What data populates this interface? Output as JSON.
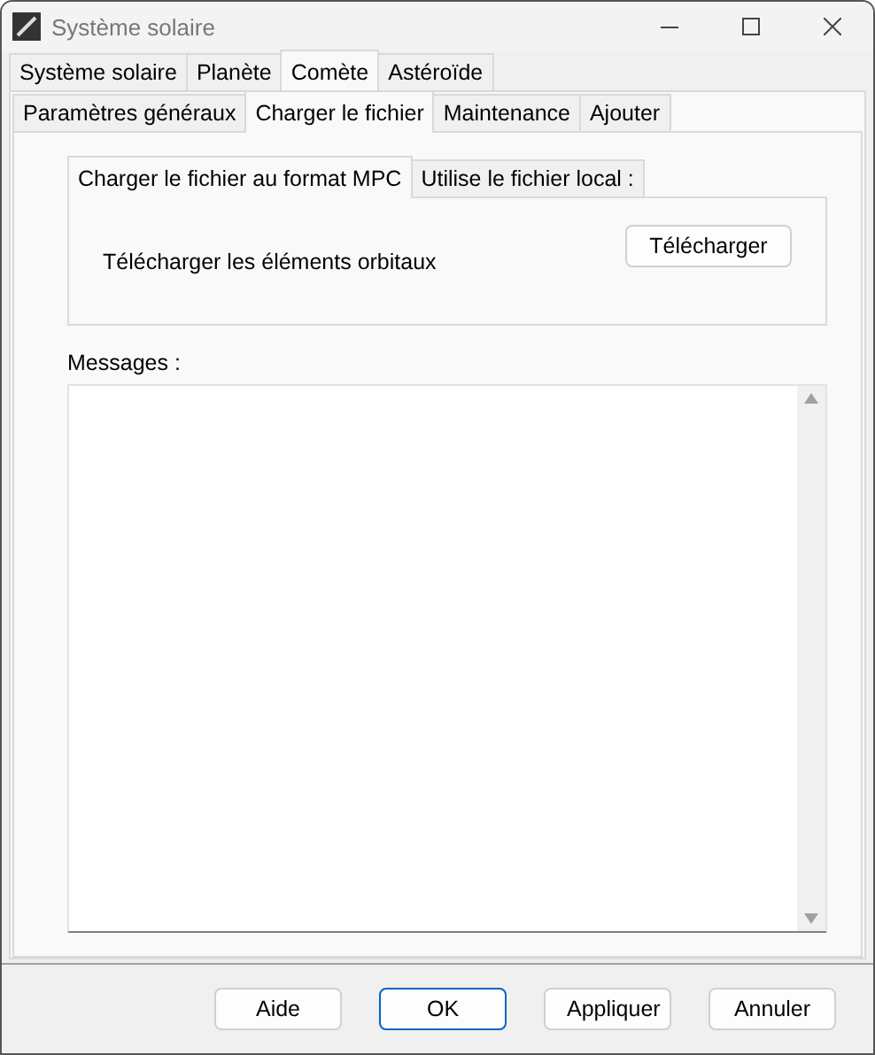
{
  "window": {
    "title": "Système solaire"
  },
  "tabs": [
    {
      "label": "Système solaire",
      "selected": false
    },
    {
      "label": "Planète",
      "selected": false
    },
    {
      "label": "Comète",
      "selected": true
    },
    {
      "label": "Astéroïde",
      "selected": false
    }
  ],
  "subtabs": [
    {
      "label": "Paramètres généraux",
      "selected": false
    },
    {
      "label": "Charger le fichier",
      "selected": true
    },
    {
      "label": "Maintenance",
      "selected": false
    },
    {
      "label": "Ajouter",
      "selected": false
    }
  ],
  "inner_tabs": [
    {
      "label": "Charger le fichier au format MPC",
      "selected": true
    },
    {
      "label": "Utilise le fichier local :",
      "selected": false
    }
  ],
  "download": {
    "label": "Télécharger les éléments orbitaux",
    "button": "Télécharger"
  },
  "messages": {
    "label": "Messages :"
  },
  "buttons": [
    {
      "label": "Aide",
      "default": false
    },
    {
      "label": "OK",
      "default": true
    },
    {
      "label": "Appliquer",
      "default": false
    },
    {
      "label": "Annuler",
      "default": false
    }
  ]
}
